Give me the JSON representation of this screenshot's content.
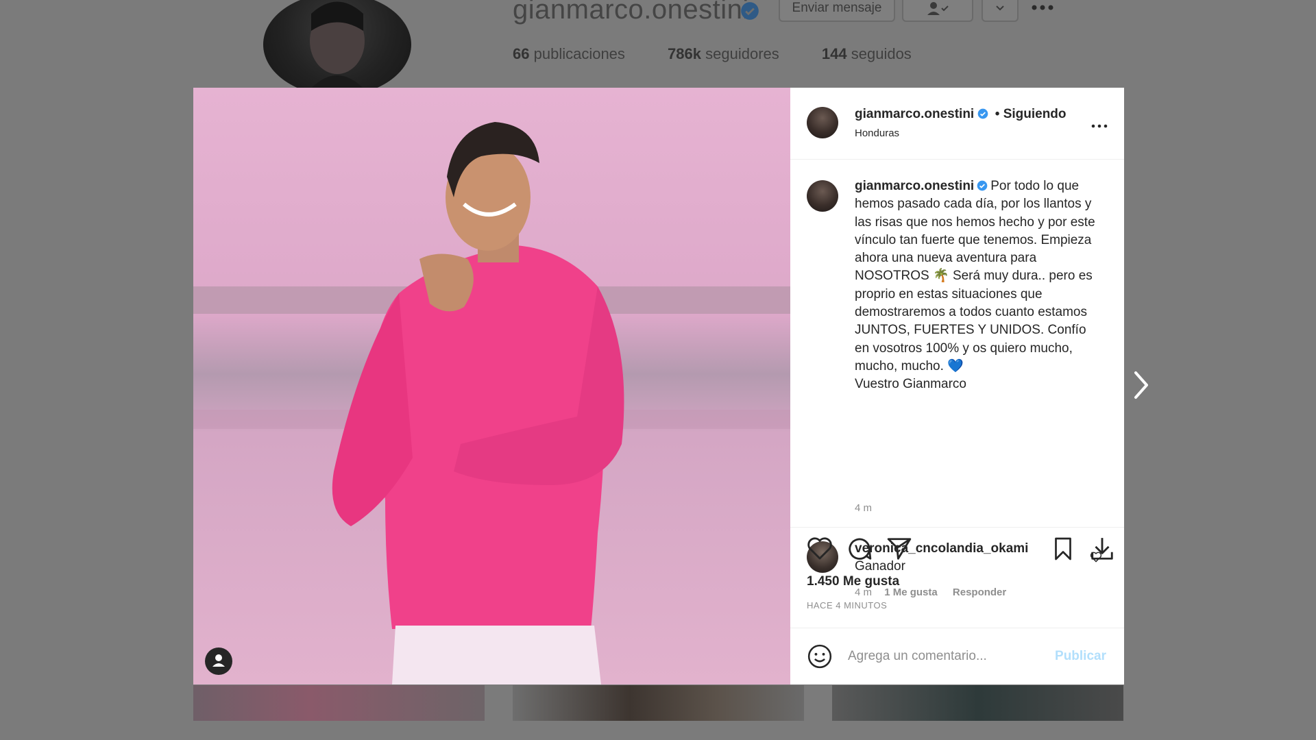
{
  "profile": {
    "username": "gianmarco.onestini",
    "send_message_label": "Enviar mensaje",
    "stats": [
      {
        "value": "66",
        "label": "publicaciones"
      },
      {
        "value": "786k",
        "label": "seguidores"
      },
      {
        "value": "144",
        "label": "seguidos"
      }
    ]
  },
  "post": {
    "username": "gianmarco.onestini",
    "follow_status": "• Siguiendo",
    "location": "Honduras",
    "caption": "Por todo lo que hemos pasado cada día, por los llantos y las risas que nos hemos hecho y por este vínculo tan fuerte que tenemos. Empieza ahora una nueva aventura para NOSOTROS 🌴 Será muy dura.. pero es proprio en estas situaciones que demostraremos a todos cuanto estamos JUNTOS, FUERTES Y UNIDOS. Confío en vosotros 100% y os quiero mucho, mucho, mucho. 💙\nVuestro Gianmarco",
    "caption_time": "4 m",
    "comments": [
      {
        "username": "veronica_cncolandia_okami",
        "text": "Ganador",
        "time": "4 m",
        "likes": "1 Me gusta",
        "reply_label": "Responder"
      }
    ],
    "likes_text": "1.450 Me gusta",
    "posted_time": "HACE 4 MINUTOS",
    "comment_placeholder": "Agrega un comentario...",
    "publish_label": "Publicar"
  },
  "icons": {
    "verified": "verified-badge-icon",
    "more": "more-options-icon",
    "like": "heart-icon",
    "comment": "comment-icon",
    "share": "paper-plane-icon",
    "save": "bookmark-icon",
    "download": "download-icon",
    "emoji": "emoji-icon",
    "next": "chevron-right-icon",
    "tag": "user-tag-icon"
  },
  "colors": {
    "verified": "#3897f0",
    "publish_disabled": "#b2dffc",
    "sweater": "#f0418a",
    "overlay": "#7b7b7b"
  }
}
